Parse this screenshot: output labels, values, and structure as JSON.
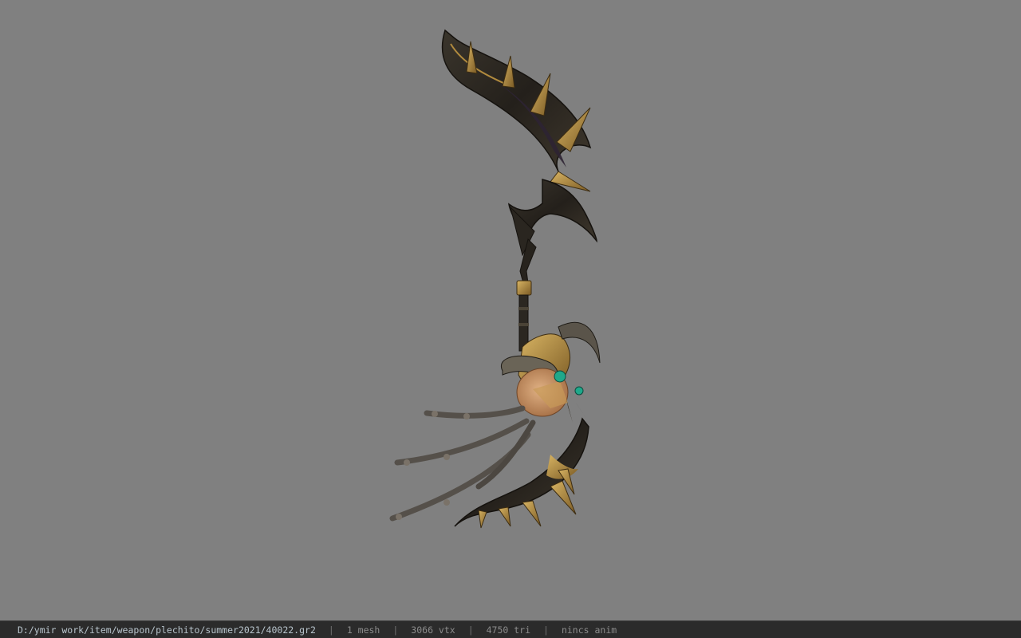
{
  "viewport": {
    "background": "#808080",
    "model_name": "weapon-scythe-model"
  },
  "status_bar": {
    "file_path": "D:/ymir work/item/weapon/plechito/summer2021/40022.gr2",
    "separator": "|",
    "mesh_count": "1 mesh",
    "vertex_count": "3066 vtx",
    "triangle_count": "4750 tri",
    "anim_status": "nincs anim"
  },
  "colors": {
    "statusbar_bg": "#2b2b2b",
    "path_text": "#b8c4cc",
    "stat_text": "#8c8c8c",
    "blade_dark": "#2a2620",
    "blade_purple": "#2e2433",
    "gold_trim": "#b08a3e",
    "skull": "#c9966a",
    "gem": "#1fa88a"
  }
}
